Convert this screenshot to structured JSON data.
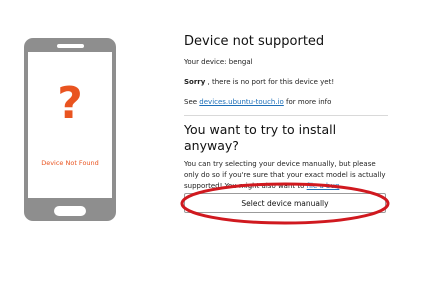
{
  "illustration": {
    "symbol": "?",
    "caption": "Device Not Found",
    "accent_color": "#e95420",
    "phone_color": "#8e8e8e"
  },
  "not_supported": {
    "title": "Device not supported",
    "device_line": "Your device: bengal",
    "sorry_bold": "Sorry",
    "sorry_rest": " , there is no port for this device yet!",
    "see_prefix": "See ",
    "see_link": "devices.ubuntu-touch.io",
    "see_suffix": " for more info"
  },
  "install_anyway": {
    "title": "You want to try to install anyway?",
    "desc_prefix": "You can try selecting your device manually, but please only do so if you're sure that your exact model is actually supported! You might also want to ",
    "bug_link": "file a bug",
    "desc_suffix": ".",
    "button_label": "Select device manually"
  },
  "annotation": {
    "ellipse_color": "#d0191f"
  }
}
